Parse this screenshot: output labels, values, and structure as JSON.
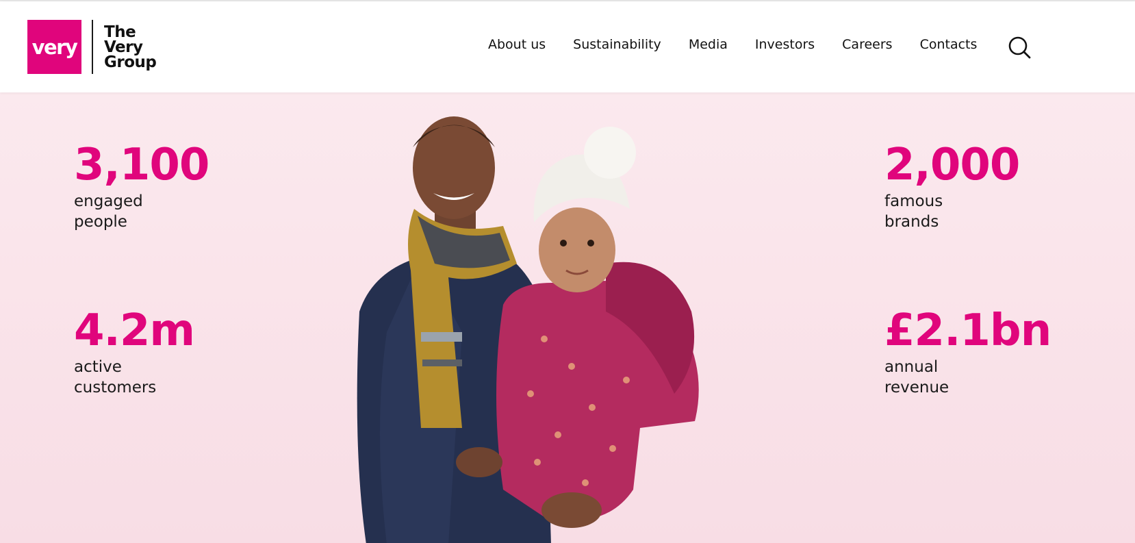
{
  "brand": {
    "mark_text": "very",
    "wordmark_lines": [
      "The",
      "Very",
      "Group"
    ],
    "color": "#e0057c"
  },
  "nav": {
    "items": [
      {
        "label": "About us"
      },
      {
        "label": "Sustainability"
      },
      {
        "label": "Media"
      },
      {
        "label": "Investors"
      },
      {
        "label": "Careers"
      },
      {
        "label": "Contacts"
      }
    ],
    "search_icon": "search-icon"
  },
  "stats": {
    "people": {
      "value": "3,100",
      "label_lines": [
        "engaged",
        "people"
      ]
    },
    "customers": {
      "value": "4.2m",
      "label_lines": [
        "active",
        "customers"
      ]
    },
    "brands": {
      "value": "2,000",
      "label_lines": [
        "famous",
        "brands"
      ]
    },
    "revenue": {
      "value": "£2.1bn",
      "label_lines": [
        "annual",
        "revenue"
      ]
    }
  },
  "colors": {
    "accent": "#e0057c",
    "hero_top": "#fbe9ee",
    "hero_bottom": "#f8dde5"
  }
}
